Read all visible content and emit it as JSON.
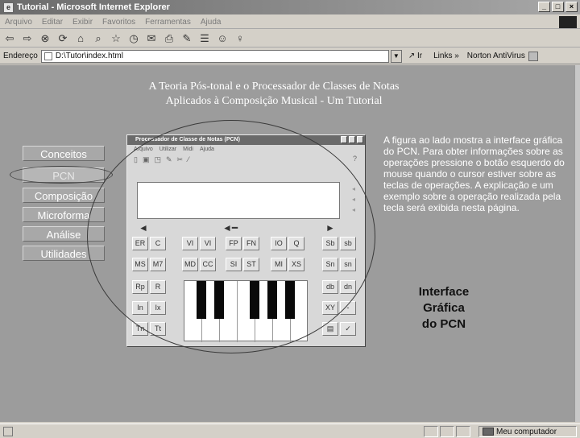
{
  "window": {
    "title": "Tutorial - Microsoft Internet Explorer",
    "controls": [
      "_",
      "̲",
      "×"
    ]
  },
  "menu": [
    "Arquivo",
    "Editar",
    "Exibir",
    "Favoritos",
    "Ferramentas",
    "Ajuda"
  ],
  "address": {
    "label": "Endereço",
    "value": "D:\\Tutor\\index.html",
    "go": "Ir",
    "links": "Links »",
    "norton": "Norton AntiVirus"
  },
  "page": {
    "title_line1": "A Teoria Pós-tonal e o Processador de Classes de Notas",
    "title_line2": "Aplicados à Composição Musical - Um Tutorial"
  },
  "nav": [
    "Conceitos",
    "PCN",
    "Composição",
    "Microforma",
    "Análise",
    "Utilidades"
  ],
  "pcn": {
    "title": "Processador de Classe de Notas (PCN)",
    "menu": [
      "Arquivo",
      "Utilizar",
      "Midi",
      "Ajuda"
    ],
    "help": "?",
    "keys": {
      "row1": [
        "ER",
        "C",
        "VI",
        "VI",
        "FP",
        "FN",
        "IO",
        "Q",
        "Sb",
        "sb"
      ],
      "row2": [
        "MS",
        "M7",
        "MD",
        "CC",
        "SI",
        "ST",
        "MI",
        "XS",
        "Sn",
        "sn"
      ],
      "row3": [
        "Rp",
        "R",
        "db",
        "dn"
      ],
      "row4": [
        "In",
        "Ix",
        "XY",
        "-"
      ],
      "row5": [
        "Tn",
        "Tt",
        "✓"
      ]
    }
  },
  "description": "A figura ao lado mostra a interface gráfica do PCN. Para obter informações sobre as operações pressione o botão esquerdo do mouse quando o cursor estiver sobre as teclas de operações. A explicação e um exemplo sobre a operação realizada pela tecla será exibida nesta página.",
  "caption": {
    "l1": "Interface",
    "l2": "Gráfica",
    "l3": "do PCN"
  },
  "status": {
    "zone": "Meu computador"
  }
}
